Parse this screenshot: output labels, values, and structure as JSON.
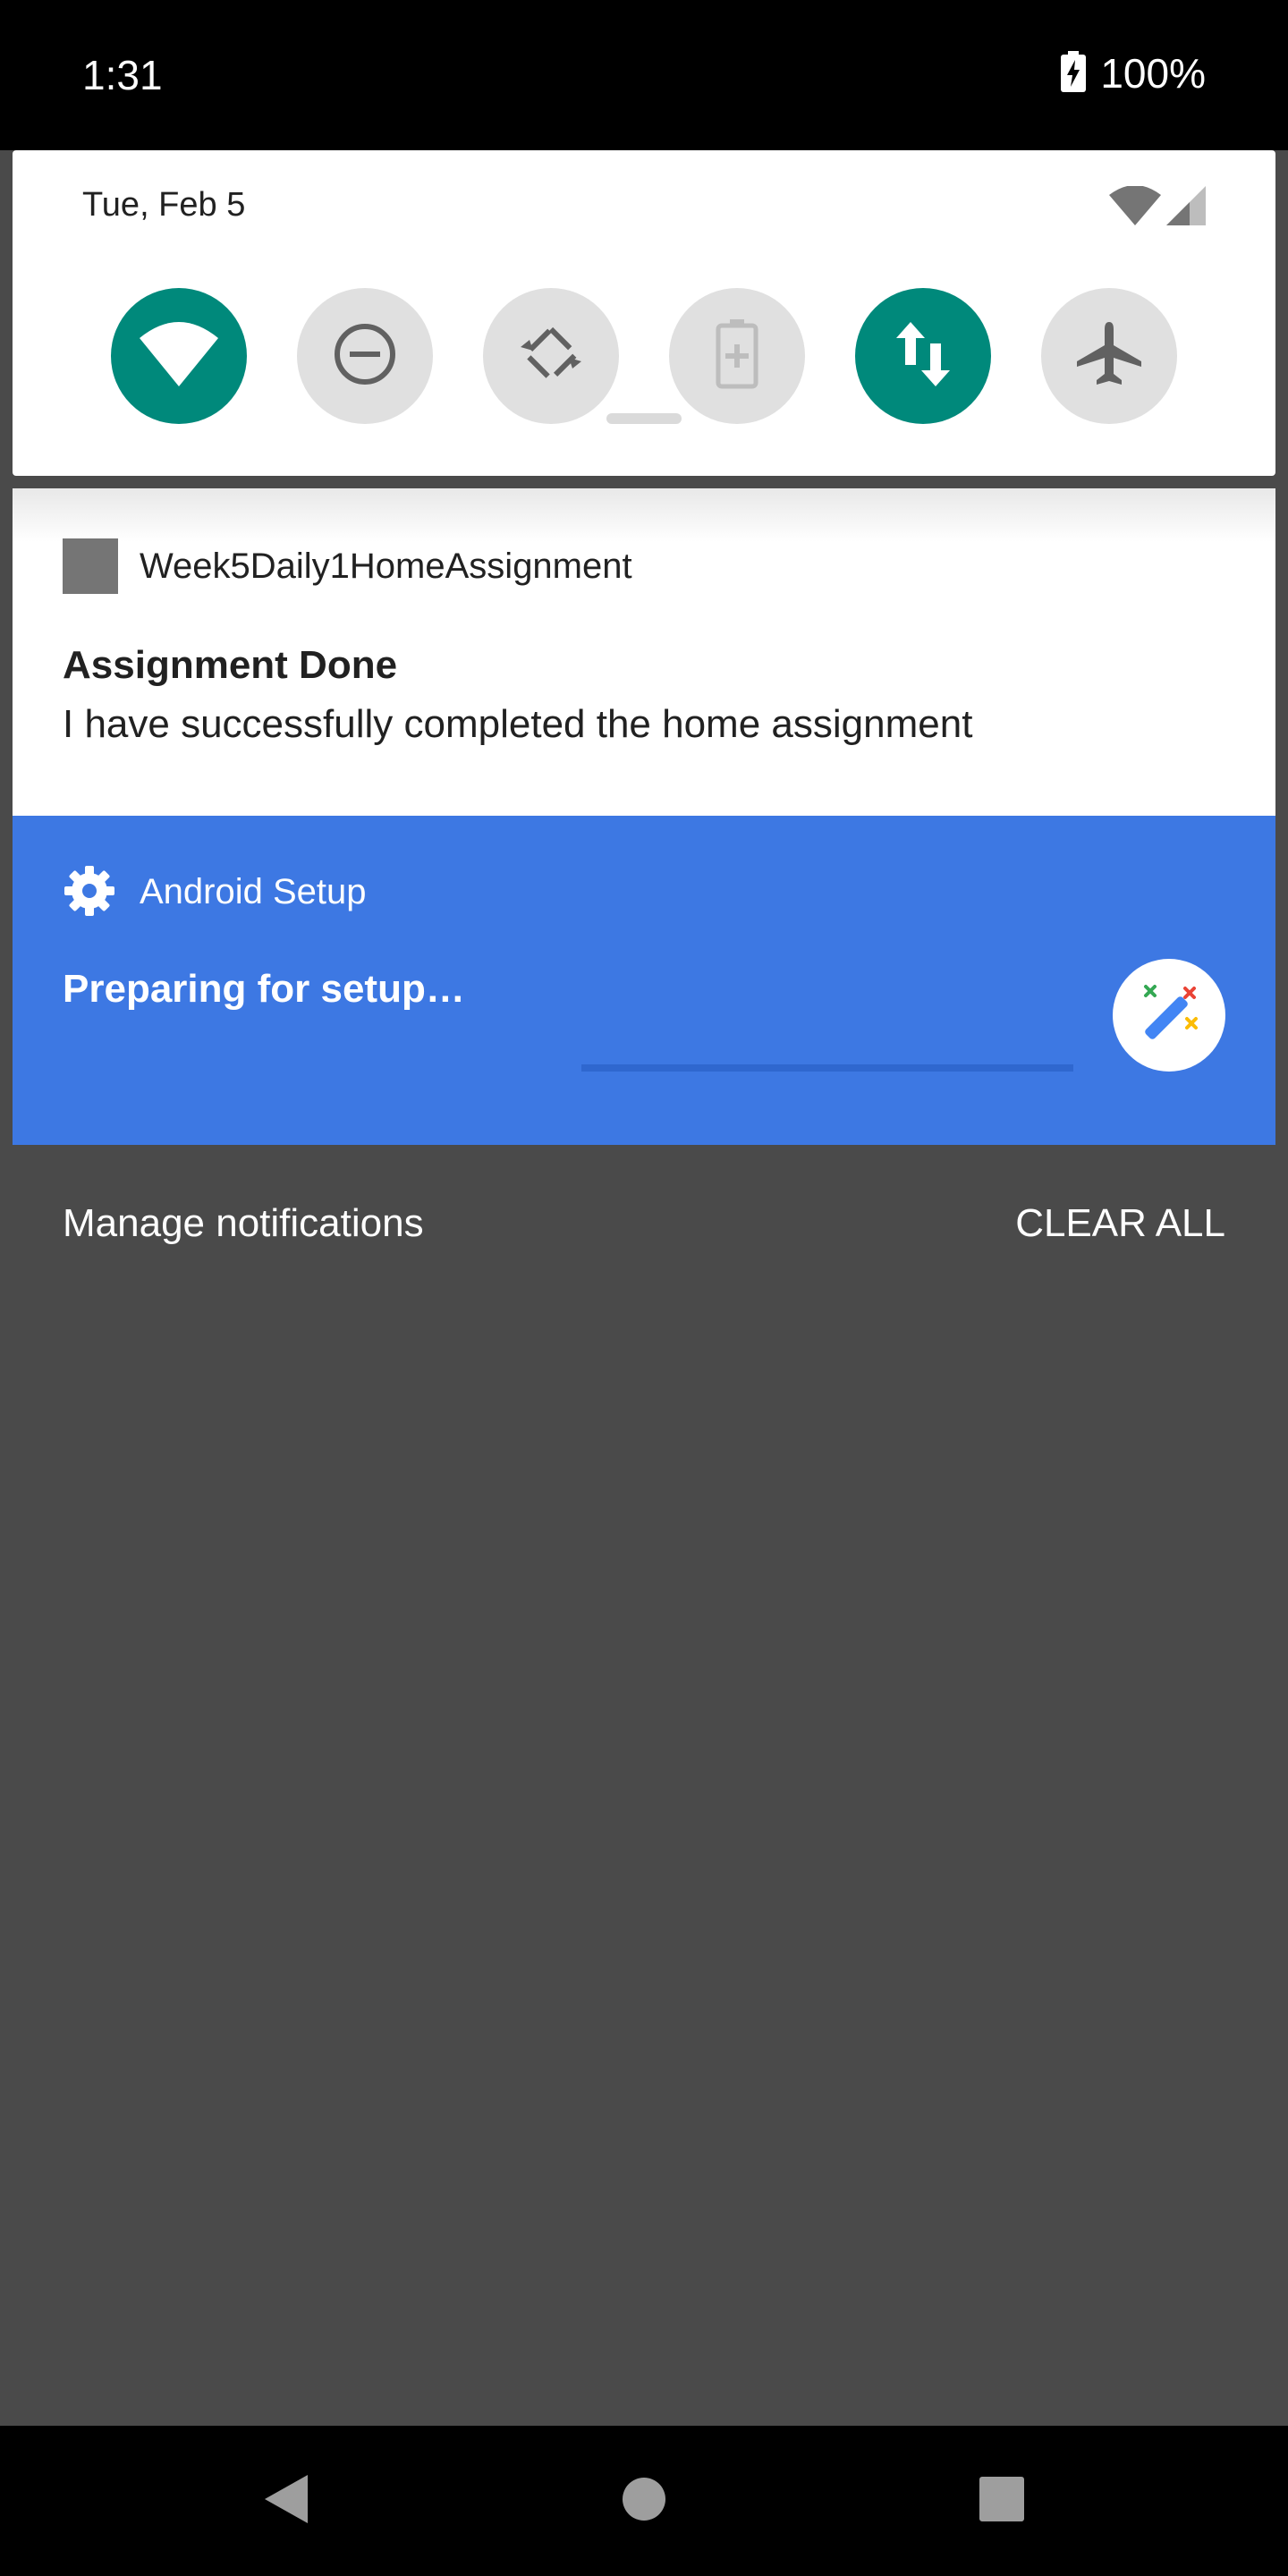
{
  "status_bar": {
    "time": "1:31",
    "battery": "100%",
    "battery_icon": "battery-charging-icon"
  },
  "quick_settings": {
    "date": "Tue, Feb 5",
    "signal_icons": [
      "wifi-icon",
      "cellular-signal-icon"
    ],
    "tiles": [
      {
        "name": "wifi",
        "icon": "wifi-icon",
        "active": true
      },
      {
        "name": "do-not-disturb",
        "icon": "do-not-disturb-icon",
        "active": false
      },
      {
        "name": "auto-rotate",
        "icon": "auto-rotate-icon",
        "active": false
      },
      {
        "name": "battery-saver",
        "icon": "battery-saver-icon",
        "active": false
      },
      {
        "name": "mobile-data",
        "icon": "data-transfer-icon",
        "active": true
      },
      {
        "name": "airplane-mode",
        "icon": "airplane-icon",
        "active": false
      }
    ],
    "active_color": "#00897b",
    "inactive_color": "#e0e0e0"
  },
  "notifications": [
    {
      "app_name": "Week5Daily1HomeAssignment",
      "title": "Assignment Done",
      "text": "I have successfully completed the home assignment"
    },
    {
      "app_name": "Android Setup",
      "title": "Preparing for setup…",
      "icon": "gear-icon",
      "badge_icon": "magic-wand-icon",
      "background": "#3d78e3"
    }
  ],
  "footer": {
    "manage_label": "Manage notifications",
    "clear_label": "CLEAR ALL"
  },
  "nav_bar": {
    "buttons": [
      "back-icon",
      "home-icon",
      "recents-icon"
    ]
  }
}
